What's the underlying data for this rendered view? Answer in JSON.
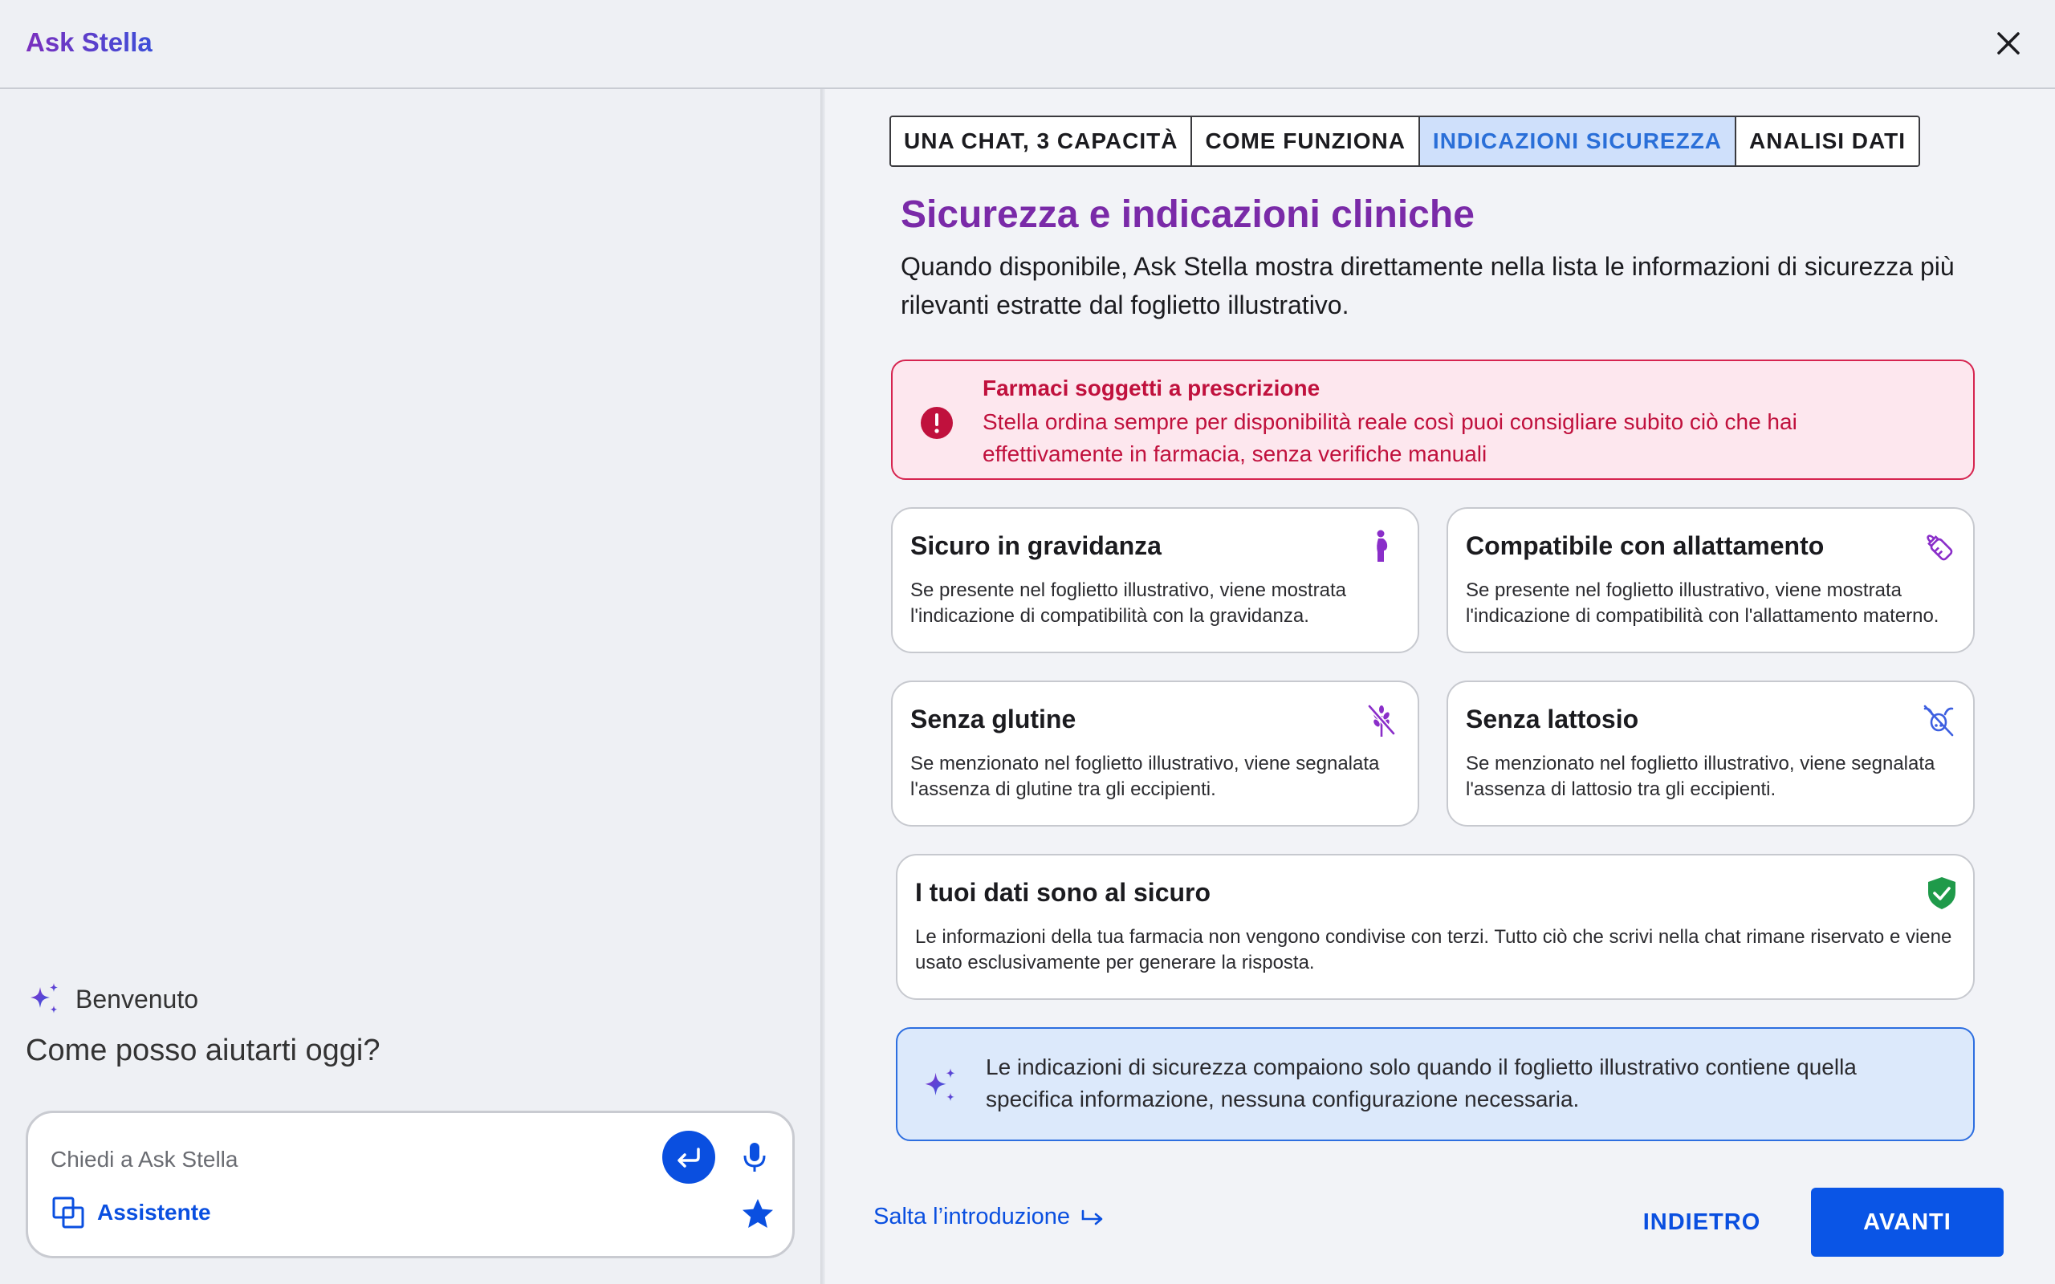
{
  "app": {
    "title": "Ask Stella"
  },
  "colors": {
    "accent": "#0a4fe0",
    "brand_purple": "#7a2aa8",
    "alert_red": "#c0113d",
    "safe_green": "#1f9a4a",
    "active_tab_bg": "#cfe0fb"
  },
  "left": {
    "welcome": "Benvenuto",
    "greeting": "Come posso aiutarti oggi?",
    "composer": {
      "placeholder": "Chiedi a Ask Stella",
      "value": "",
      "assistant_label": "Assistente"
    }
  },
  "tabs": [
    {
      "label": "UNA CHAT, 3 CAPACITÀ",
      "active": false
    },
    {
      "label": "COME FUNZIONA",
      "active": false
    },
    {
      "label": "INDICAZIONI SICUREZZA",
      "active": true
    },
    {
      "label": "ANALISI DATI",
      "active": false
    }
  ],
  "main": {
    "title": "Sicurezza e indicazioni cliniche",
    "description": "Quando disponibile, Ask Stella mostra direttamente nella lista le informazioni di sicurezza più rilevanti estratte dal foglietto illustrativo.",
    "alert": {
      "title": "Farmaci soggetti a prescrizione",
      "body": "Stella ordina sempre per disponibilità reale così puoi consigliare subito ciò che hai effettivamente in farmacia, senza verifiche manuali"
    },
    "cards": [
      {
        "title": "Sicuro in gravidanza",
        "body": "Se presente nel foglietto illustrativo, viene mostrata l'indicazione di compatibilità con la gravidanza.",
        "icon": "pregnancy-icon"
      },
      {
        "title": "Compatibile con allattamento",
        "body": "Se presente nel foglietto illustrativo, viene mostrata l'indicazione di compatibilità con l'allattamento materno.",
        "icon": "baby-bottle-icon"
      },
      {
        "title": "Senza glutine",
        "body": "Se menzionato nel foglietto illustrativo, viene segnalata l'assenza di glutine tra gli eccipienti.",
        "icon": "gluten-free-icon"
      },
      {
        "title": "Senza lattosio",
        "body": "Se menzionato nel foglietto illustrativo, viene segnalata l'assenza di lattosio tra gli eccipienti.",
        "icon": "lactose-free-icon"
      },
      {
        "title": "I tuoi dati sono al sicuro",
        "body": "Le informazioni della tua farmacia non vengono condivise con terzi. Tutto ciò che scrivi nella chat rimane riservato e viene usato esclusivamente per generare la risposta.",
        "icon": "shield-check-icon"
      }
    ],
    "info": "Le indicazioni di sicurezza compaiono solo quando il foglietto illustrativo contiene quella specifica informazione, nessuna configurazione necessaria."
  },
  "footer": {
    "skip": "Salta l’introduzione",
    "back": "INDIETRO",
    "next": "AVANTI"
  }
}
